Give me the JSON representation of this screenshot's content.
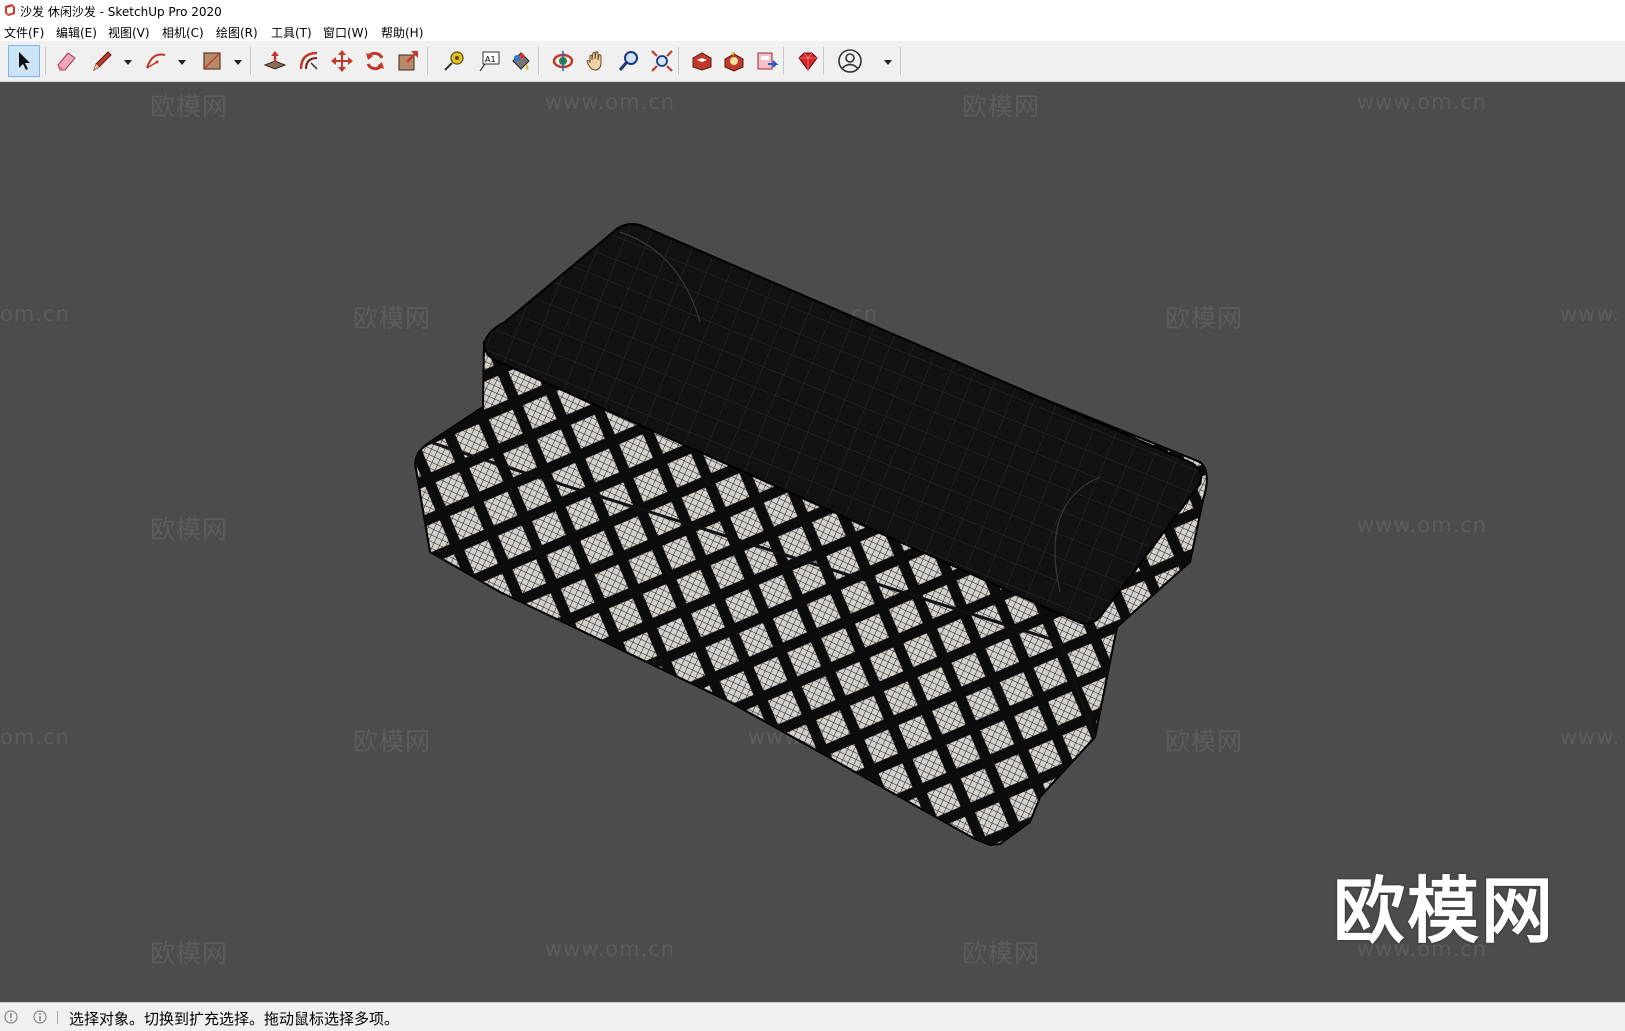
{
  "window": {
    "title": "沙发 休闲沙发 - SketchUp Pro 2020",
    "app_icon": "sketchup-logo-icon"
  },
  "menubar": {
    "items": [
      {
        "label": "文件(F)"
      },
      {
        "label": "编辑(E)"
      },
      {
        "label": "视图(V)"
      },
      {
        "label": "相机(C)"
      },
      {
        "label": "绘图(R)"
      },
      {
        "label": "工具(T)"
      },
      {
        "label": "窗口(W)"
      },
      {
        "label": "帮助(H)"
      }
    ]
  },
  "toolbar": {
    "tools": [
      {
        "name": "select-tool",
        "icon": "arrow-cursor-icon",
        "active": true
      },
      {
        "name": "eraser-tool",
        "icon": "eraser-icon"
      },
      {
        "name": "line-tool",
        "icon": "pencil-icon",
        "dropdown": true
      },
      {
        "name": "arc-tool",
        "icon": "arc-icon",
        "dropdown": true
      },
      {
        "name": "shape-tool",
        "icon": "rectangle-icon",
        "dropdown": true
      },
      {
        "name": "push-pull-tool",
        "icon": "push-pull-icon"
      },
      {
        "name": "offset-tool",
        "icon": "offset-icon"
      },
      {
        "name": "move-tool",
        "icon": "move-arrows-icon"
      },
      {
        "name": "rotate-tool",
        "icon": "rotate-icon"
      },
      {
        "name": "scale-tool",
        "icon": "scale-icon"
      },
      {
        "name": "tape-measure-tool",
        "icon": "tape-measure-icon"
      },
      {
        "name": "text-tool",
        "icon": "text-icon"
      },
      {
        "name": "paint-bucket-tool",
        "icon": "paint-bucket-icon"
      },
      {
        "name": "orbit-tool",
        "icon": "orbit-icon"
      },
      {
        "name": "pan-tool",
        "icon": "hand-icon"
      },
      {
        "name": "zoom-tool",
        "icon": "magnifier-icon"
      },
      {
        "name": "zoom-extents-tool",
        "icon": "zoom-extents-icon"
      },
      {
        "name": "3d-warehouse",
        "icon": "warehouse-icon"
      },
      {
        "name": "extension-warehouse",
        "icon": "extension-warehouse-icon"
      },
      {
        "name": "layout-send",
        "icon": "layout-icon"
      },
      {
        "name": "extension-manager",
        "icon": "ruby-gem-icon"
      },
      {
        "name": "account",
        "icon": "user-account-icon",
        "dropdown": true
      }
    ],
    "text_tool_glyph": "A1"
  },
  "viewport": {
    "background": "#4c4c4c",
    "watermark_logo": "欧模网",
    "watermark_url": "www.om.cn",
    "watermark_url_partial": "om.cn",
    "watermark_url_partial_right": "www.",
    "big_logo": "欧模网",
    "model": "sofa-wireframe-model"
  },
  "statusbar": {
    "icons": [
      "location-icon",
      "info-icon"
    ],
    "text": "选择对象。切换到扩充选择。拖动鼠标选择多项。"
  }
}
